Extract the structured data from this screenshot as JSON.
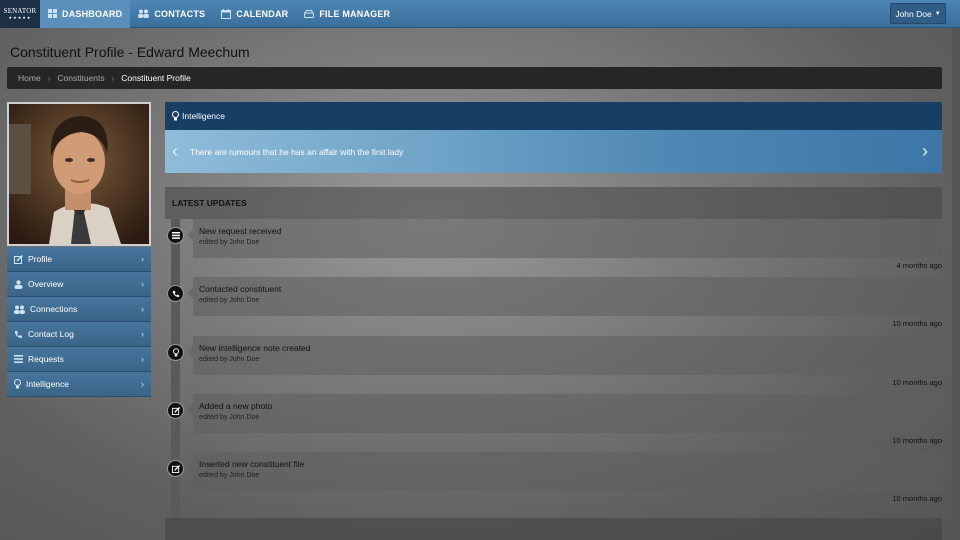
{
  "brand": {
    "name": "SENATOR",
    "stars": "★★★★★"
  },
  "nav": {
    "items": [
      {
        "label": "DASHBOARD",
        "icon": "grid-icon",
        "active": true
      },
      {
        "label": "CONTACTS",
        "icon": "users-icon",
        "active": false
      },
      {
        "label": "CALENDAR",
        "icon": "calendar-icon",
        "active": false
      },
      {
        "label": "FILE MANAGER",
        "icon": "drive-icon",
        "active": false
      }
    ],
    "user": "John Doe"
  },
  "page": {
    "title": "Constituent Profile - Edward Meechum"
  },
  "breadcrumb": [
    "Home",
    "Constituents",
    "Constituent Profile"
  ],
  "sidebar": {
    "items": [
      {
        "label": "Profile",
        "icon": "edit-icon"
      },
      {
        "label": "Overview",
        "icon": "user-icon"
      },
      {
        "label": "Connections",
        "icon": "users-icon"
      },
      {
        "label": "Contact Log",
        "icon": "phone-icon"
      },
      {
        "label": "Requests",
        "icon": "list-icon"
      },
      {
        "label": "Intelligence",
        "icon": "lightbulb-icon"
      }
    ]
  },
  "intelligence": {
    "heading": "Intelligence",
    "note": "There are rumours that he has an affair with the first lady"
  },
  "updates": {
    "heading": "LATEST UPDATES",
    "entries": [
      {
        "title": "New request received",
        "by": "edited by John Doe",
        "time": "4 months ago",
        "icon": "list-icon"
      },
      {
        "title": "Contacted constituent",
        "by": "edited by John Doe",
        "time": "10 months ago",
        "icon": "phone-icon"
      },
      {
        "title": "New intelligence note created",
        "by": "edited by John Doe",
        "time": "10 months ago",
        "icon": "lightbulb-icon"
      },
      {
        "title": "Added a new photo",
        "by": "edited by John Doe",
        "time": "10 months ago",
        "icon": "edit-icon"
      },
      {
        "title": "Inserted new constituent file",
        "by": "edited by John Doe",
        "time": "10 months ago",
        "icon": "edit-icon"
      }
    ]
  },
  "colors": {
    "nav": "#3f78a7",
    "breadcrumb": "#262626",
    "intel_head": "#173e64",
    "sidebar": "#3f6d93"
  }
}
